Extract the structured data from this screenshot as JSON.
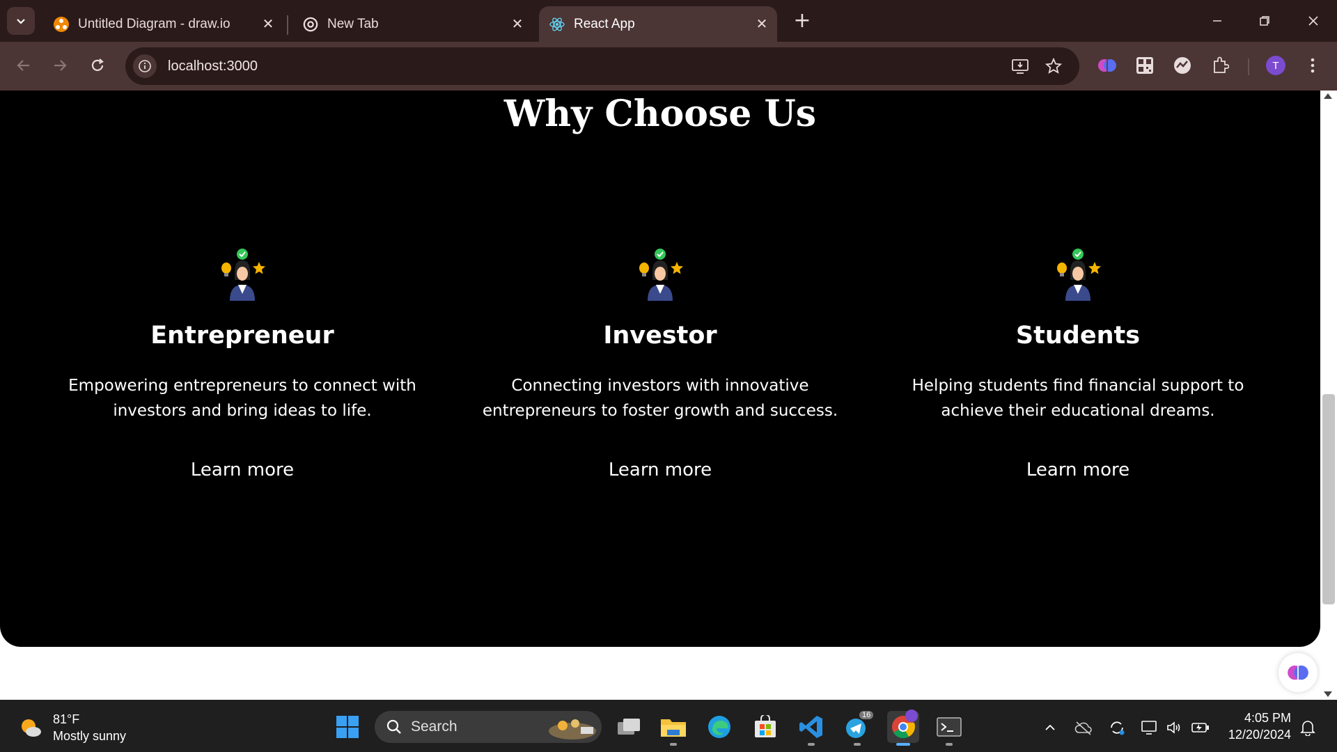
{
  "browser": {
    "tabs": [
      {
        "title": "Untitled Diagram - draw.io",
        "close": "✕"
      },
      {
        "title": "New Tab",
        "close": "✕"
      },
      {
        "title": "React App",
        "close": "✕"
      }
    ],
    "new_tab": "+",
    "url": "localhost:3000",
    "profile_initial": "T",
    "window_controls": {
      "minimize": "—",
      "restore": "❐",
      "close": "✕"
    }
  },
  "page": {
    "section_title": "Why Choose Us",
    "cards": [
      {
        "title": "Entrepreneur",
        "description": "Empowering entrepreneurs to connect with investors and bring ideas to life.",
        "link": "Learn more"
      },
      {
        "title": "Investor",
        "description": "Connecting investors with innovative entrepreneurs to foster growth and success.",
        "link": "Learn more"
      },
      {
        "title": "Students",
        "description": "Helping students find financial support to achieve their educational dreams.",
        "link": "Learn more"
      }
    ]
  },
  "taskbar": {
    "weather": {
      "temp": "81°F",
      "condition": "Mostly sunny"
    },
    "search_label": "Search",
    "telegram_badge": "16",
    "time": "4:05 PM",
    "date": "12/20/2024"
  },
  "colors": {
    "tab_bar": "#2b1a1a",
    "toolbar": "#4c3535",
    "section_bg": "#000000",
    "page_bg": "#ffffff",
    "profile": "#7b4bd0"
  }
}
